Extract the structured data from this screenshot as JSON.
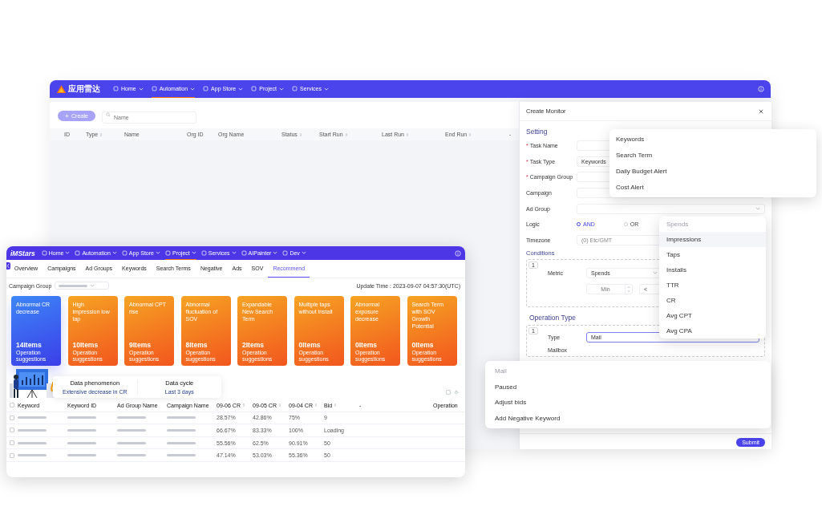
{
  "back_window": {
    "logo": "应用雷达",
    "nav": [
      {
        "label": "Home",
        "selected": false
      },
      {
        "label": "Automation",
        "selected": true
      },
      {
        "label": "App Store",
        "selected": false
      },
      {
        "label": "Project",
        "selected": false
      },
      {
        "label": "Services",
        "selected": false
      }
    ],
    "create_button": "Create",
    "search": {
      "placeholder": "Name"
    },
    "table": {
      "columns": [
        {
          "label": "ID",
          "sortable": false
        },
        {
          "label": "Type",
          "sortable": true
        },
        {
          "label": "Name",
          "sortable": false
        },
        {
          "label": "Org ID",
          "sortable": false
        },
        {
          "label": "Org Name",
          "sortable": false
        },
        {
          "label": "Status",
          "sortable": true
        },
        {
          "label": "Start Run",
          "sortable": true
        },
        {
          "label": "Last Run",
          "sortable": true
        },
        {
          "label": "End Run",
          "sortable": true
        },
        {
          "label": "-",
          "sortable": false
        }
      ]
    }
  },
  "create_monitor": {
    "title": "Create Monitor",
    "setting_heading": "Setting",
    "fields": [
      {
        "label": "Task Name",
        "required_mark": "*",
        "kind": "input"
      },
      {
        "label": "Task Type",
        "required_mark": "*",
        "kind": "input",
        "value": "Keywords"
      },
      {
        "label": "Campaign Group",
        "required_mark": "*",
        "kind": "input"
      },
      {
        "label": "Campaign",
        "kind": "input"
      },
      {
        "label": "Ad Group",
        "kind": "select"
      }
    ],
    "logic": {
      "label": "Logic",
      "options": [
        {
          "label": "AND",
          "selected": true
        },
        {
          "label": "OR",
          "selected": false
        }
      ]
    },
    "timezone": {
      "label": "Timezone",
      "value": "(0) Etc/GMT"
    },
    "conditions_heading": "Conditions",
    "condition": {
      "index": "1",
      "metric_label": "Metric",
      "metric_value": "Spends",
      "min_placeholder": "Min",
      "operator": "<"
    },
    "operation_heading": "Operation Type",
    "operation": {
      "index": "1",
      "type_label": "Type",
      "type_value": "Mail",
      "mailbox_label": "Mailbox"
    },
    "submit": "Submit"
  },
  "task_type_menu": {
    "items": [
      "Keywords",
      "Search Term",
      "Daily Budget Alert",
      "Cost Alert"
    ]
  },
  "metric_menu": {
    "items": [
      {
        "label": "Spends",
        "selected": true,
        "highlighted": false
      },
      {
        "label": "Impressions",
        "selected": false,
        "highlighted": true
      },
      {
        "label": "Taps",
        "selected": false,
        "highlighted": false
      },
      {
        "label": "Installs",
        "selected": false,
        "highlighted": false
      },
      {
        "label": "TTR",
        "selected": false,
        "highlighted": false
      },
      {
        "label": "CR",
        "selected": false,
        "highlighted": false
      },
      {
        "label": "Avg CPT",
        "selected": false,
        "highlighted": false
      },
      {
        "label": "Avg CPA",
        "selected": false,
        "highlighted": false
      }
    ]
  },
  "operation_menu": {
    "items": [
      {
        "label": "Mail",
        "selected": true
      },
      {
        "label": "Paused",
        "selected": false
      },
      {
        "label": "Adjust bids",
        "selected": false
      },
      {
        "label": "Add Negative Keyword",
        "selected": false
      }
    ]
  },
  "front_window": {
    "logo": "iMStars",
    "nav": [
      {
        "label": "Home",
        "selected": false
      },
      {
        "label": "Automation",
        "selected": false
      },
      {
        "label": "App Store",
        "selected": false
      },
      {
        "label": "Project",
        "selected": true
      },
      {
        "label": "Services",
        "selected": false
      },
      {
        "label": "AIPainter",
        "selected": false
      },
      {
        "label": "Dev",
        "selected": false
      }
    ],
    "tabs": [
      {
        "label": "Overview",
        "selected": false
      },
      {
        "label": "Campaigns",
        "selected": false
      },
      {
        "label": "Ad Groups",
        "selected": false
      },
      {
        "label": "Keywords",
        "selected": false
      },
      {
        "label": "Search Terms",
        "selected": false
      },
      {
        "label": "Negative",
        "selected": false
      },
      {
        "label": "Ads",
        "selected": false
      },
      {
        "label": "SOV",
        "selected": false
      },
      {
        "label": "Recommend",
        "selected": true
      }
    ],
    "campaign_group_label": "Campaign Group",
    "update_time": "Update Time : 2023-09-07 04:57:30(UTC)",
    "cards": [
      {
        "title": "Abnormal CR decrease",
        "count": "14Items",
        "caption": "Operation suggestions",
        "selected": true
      },
      {
        "title": "High impression low tap",
        "count": "10Items",
        "caption": "Operation suggestions",
        "selected": false
      },
      {
        "title": "Abnormal CPT rise",
        "count": "9Items",
        "caption": "Operation suggestions",
        "selected": false
      },
      {
        "title": "Abnormal fluctuation of SOV",
        "count": "8Items",
        "caption": "Operation suggestions",
        "selected": false
      },
      {
        "title": "Expandable New Search Term",
        "count": "2Items",
        "caption": "Operation suggestions",
        "selected": false
      },
      {
        "title": "Multiple taps without install",
        "count": "0Items",
        "caption": "Operation suggestions",
        "selected": false
      },
      {
        "title": "Abnormal exposure decrease",
        "count": "0Items",
        "caption": "Operation suggestions",
        "selected": false
      },
      {
        "title": "Search Term with SOV Growth Potential",
        "count": "0Items",
        "caption": "Operation suggestions",
        "selected": false
      }
    ],
    "summary": {
      "phenomenon_label": "Data phenomenon",
      "phenomenon_value": "Extensive decrease in CR",
      "cycle_label": "Data cycle",
      "cycle_value": "Last 3 days"
    },
    "table": {
      "all_checked": false,
      "columns": [
        {
          "label": "Keyword",
          "sortable": false
        },
        {
          "label": "Keyword ID",
          "sortable": false
        },
        {
          "label": "Ad Group Name",
          "sortable": false
        },
        {
          "label": "Campaign Name",
          "sortable": false
        },
        {
          "label": "09-06 CR",
          "sortable": true
        },
        {
          "label": "09-05 CR",
          "sortable": true
        },
        {
          "label": "09-04 CR",
          "sortable": true
        },
        {
          "label": "Bid",
          "sortable": true
        },
        {
          "label": "-",
          "sortable": false
        },
        {
          "label": "Operation",
          "sortable": false
        }
      ],
      "rows": [
        {
          "checked": false,
          "cr_1": "28.57%",
          "cr_2": "42.86%",
          "cr_3": "75%",
          "bid": "9"
        },
        {
          "checked": false,
          "cr_1": "66.67%",
          "cr_2": "83.33%",
          "cr_3": "100%",
          "bid": "Loading"
        },
        {
          "checked": false,
          "cr_1": "55.56%",
          "cr_2": "62.5%",
          "cr_3": "90.91%",
          "bid": "50"
        },
        {
          "checked": false,
          "cr_1": "47.14%",
          "cr_2": "53.03%",
          "cr_3": "55.36%",
          "bid": "50"
        }
      ]
    }
  }
}
